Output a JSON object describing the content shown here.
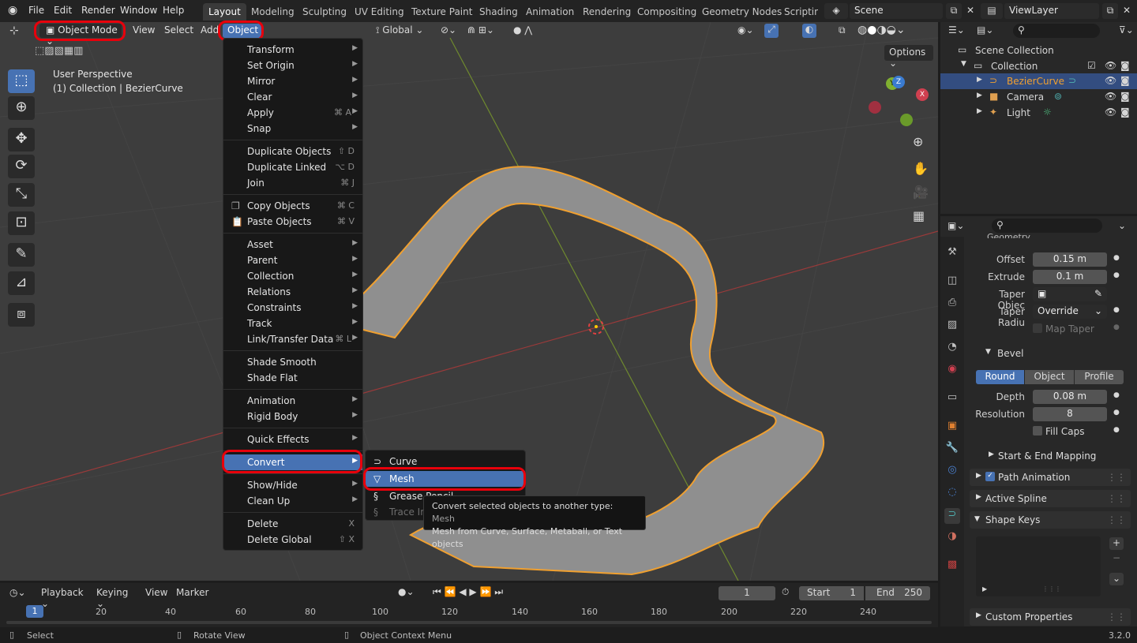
{
  "topbar": {
    "menus": [
      "File",
      "Edit",
      "Render",
      "Window",
      "Help"
    ],
    "workspaces": [
      "Layout",
      "Modeling",
      "Sculpting",
      "UV Editing",
      "Texture Paint",
      "Shading",
      "Animation",
      "Rendering",
      "Compositing",
      "Geometry Nodes",
      "Scripting"
    ],
    "active_workspace": "Layout",
    "scene": "Scene",
    "view_layer": "ViewLayer"
  },
  "viewport_header": {
    "mode": "Object Mode",
    "menus": [
      "View",
      "Select",
      "Add",
      "Object"
    ],
    "transform_orientation": "Global",
    "options_label": "Options"
  },
  "viewport": {
    "perspective_label": "User Perspective",
    "collection_label": "(1) Collection | BezierCurve",
    "gizmo_axes": [
      "X",
      "Y",
      "Z"
    ]
  },
  "object_menu": {
    "items": [
      {
        "label": "Transform",
        "submenu": true
      },
      {
        "label": "Set Origin",
        "submenu": true
      },
      {
        "label": "Mirror",
        "submenu": true
      },
      {
        "label": "Clear",
        "submenu": true
      },
      {
        "label": "Apply",
        "shortcut": "⌘ A",
        "submenu": true
      },
      {
        "label": "Snap",
        "submenu": true
      },
      {
        "label": "Duplicate Objects",
        "shortcut": "⇧ D"
      },
      {
        "label": "Duplicate Linked",
        "shortcut": "⌥ D"
      },
      {
        "label": "Join",
        "shortcut": "⌘ J"
      },
      {
        "label": "Copy Objects",
        "shortcut": "⌘ C"
      },
      {
        "label": "Paste Objects",
        "shortcut": "⌘ V"
      },
      {
        "label": "Asset",
        "submenu": true
      },
      {
        "label": "Parent",
        "submenu": true
      },
      {
        "label": "Collection",
        "submenu": true
      },
      {
        "label": "Relations",
        "submenu": true
      },
      {
        "label": "Constraints",
        "submenu": true
      },
      {
        "label": "Track",
        "submenu": true
      },
      {
        "label": "Link/Transfer Data",
        "shortcut": "⌘ L",
        "submenu": true
      },
      {
        "label": "Shade Smooth"
      },
      {
        "label": "Shade Flat"
      },
      {
        "label": "Animation",
        "submenu": true
      },
      {
        "label": "Rigid Body",
        "submenu": true
      },
      {
        "label": "Quick Effects",
        "submenu": true
      },
      {
        "label": "Convert",
        "submenu": true
      },
      {
        "label": "Show/Hide",
        "submenu": true
      },
      {
        "label": "Clean Up",
        "submenu": true
      },
      {
        "label": "Delete",
        "shortcut": "X"
      },
      {
        "label": "Delete Global",
        "shortcut": "⇧ X"
      }
    ]
  },
  "convert_submenu": {
    "items": [
      "Curve",
      "Mesh",
      "Grease Pencil",
      "Trace Im"
    ]
  },
  "tooltip": {
    "line1_prefix": "Convert selected objects to another type:",
    "line1_value": "Mesh",
    "line2": "Mesh from Curve, Surface, Metaball, or Text objects"
  },
  "outliner": {
    "root": "Scene Collection",
    "collection": "Collection",
    "objects": [
      "BezierCurve",
      "Camera",
      "Light"
    ]
  },
  "properties": {
    "section_geometry": "Geometry",
    "offset_label": "Offset",
    "offset_value": "0.15 m",
    "extrude_label": "Extrude",
    "extrude_value": "0.1 m",
    "taper_object_label": "Taper Objec",
    "taper_radius_label": "Taper Radiu",
    "taper_radius_value": "Override",
    "map_taper_label": "Map Taper",
    "bevel_label": "Bevel",
    "bevel_modes": [
      "Round",
      "Object",
      "Profile"
    ],
    "depth_label": "Depth",
    "depth_value": "0.08 m",
    "resolution_label": "Resolution",
    "resolution_value": "8",
    "fill_caps_label": "Fill Caps",
    "start_end_label": "Start & End Mapping",
    "path_animation_label": "Path Animation",
    "active_spline_label": "Active Spline",
    "shape_keys_label": "Shape Keys",
    "custom_props_label": "Custom Properties"
  },
  "timeline": {
    "menus": [
      "Playback",
      "Keying",
      "View",
      "Marker"
    ],
    "current_frame": "1",
    "start_label": "Start",
    "start_value": "1",
    "end_label": "End",
    "end_value": "250",
    "ruler": [
      "1",
      "20",
      "40",
      "60",
      "80",
      "100",
      "120",
      "140",
      "160",
      "180",
      "200",
      "220",
      "240"
    ]
  },
  "statusbar": {
    "select": "Select",
    "rotate": "Rotate View",
    "context": "Object Context Menu",
    "version": "3.2.0"
  }
}
